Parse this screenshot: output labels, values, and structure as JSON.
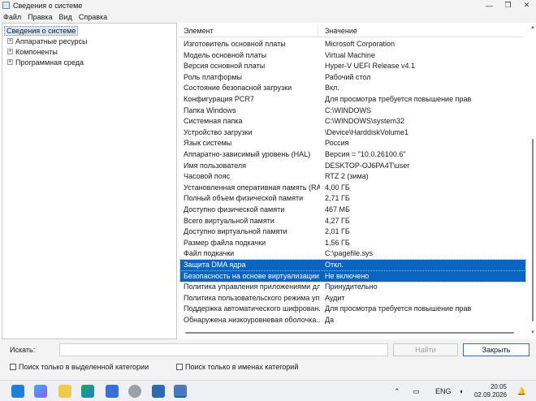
{
  "window": {
    "title": "Сведения о системе",
    "controls": {
      "minimize": "—",
      "maximize": "❐",
      "close": "✕"
    }
  },
  "menu": [
    "Файл",
    "Правка",
    "Вид",
    "Справка"
  ],
  "tree": {
    "root": "Сведения о системе",
    "children": [
      {
        "expander": "+",
        "label": "Аппаратные ресурсы"
      },
      {
        "expander": "+",
        "label": "Компоненты"
      },
      {
        "expander": "+",
        "label": "Программная среда"
      }
    ]
  },
  "list": {
    "columns": {
      "element": "Элемент",
      "value": "Значение"
    },
    "rows": [
      {
        "key": "Изготовитель основной платы",
        "value": "Microsoft Corporation"
      },
      {
        "key": "Модель основной платы",
        "value": "Virtual Machine"
      },
      {
        "key": "Версия основной платы",
        "value": "Hyper-V UEFI Release v4.1"
      },
      {
        "key": "Роль платформы",
        "value": "Рабочий стол"
      },
      {
        "key": "Состояние безопасной загрузки",
        "value": "Вкл."
      },
      {
        "key": "Конфигурация PCR7",
        "value": "Для просмотра требуется повышение прав"
      },
      {
        "key": "Папка Windows",
        "value": "C:\\WINDOWS"
      },
      {
        "key": "Системная папка",
        "value": "C:\\WINDOWS\\system32"
      },
      {
        "key": "Устройство загрузки",
        "value": "\\Device\\HarddiskVolume1"
      },
      {
        "key": "Язык системы",
        "value": "Россия"
      },
      {
        "key": "Аппаратно-зависимый уровень (HAL)",
        "value": "Версия = \"10.0.26100.6\""
      },
      {
        "key": "Имя пользователя",
        "value": "DESKTOP-OJ6PA4T\\user"
      },
      {
        "key": "Часовой пояс",
        "value": "RTZ 2 (зима)"
      },
      {
        "key": "Установленная оперативная память (RAM)",
        "value": "4,00 ГБ"
      },
      {
        "key": "Полный объем физической памяти",
        "value": "2,71 ГБ"
      },
      {
        "key": "Доступно физической памяти",
        "value": "467 МБ"
      },
      {
        "key": "Всего виртуальной памяти",
        "value": "4,27 ГБ"
      },
      {
        "key": "Доступно виртуальной памяти",
        "value": "2,01 ГБ"
      },
      {
        "key": "Размер файла подкачки",
        "value": "1,56 ГБ"
      },
      {
        "key": "Файл подкачки",
        "value": "C:\\pagefile.sys"
      },
      {
        "key": "Защита DMA ядра",
        "value": "Откл.",
        "selected": true
      },
      {
        "key": "Безопасность на основе виртуализации",
        "value": "Не включено",
        "selected": true
      },
      {
        "key": "Политика управления приложениями для ...",
        "value": "Принудительно"
      },
      {
        "key": "Политика пользовательского режима упр...",
        "value": "Аудит"
      },
      {
        "key": "Поддержка автоматического шифрован...",
        "value": "Для просмотра требуется повышение прав"
      },
      {
        "key": "Обнаружена низкоуровневая оболочка....",
        "value": "Да"
      }
    ]
  },
  "search": {
    "label": "Искать:",
    "value": "",
    "find_button": "Найти",
    "close_button": "Закрыть",
    "option_selected_category": "Поиск только в выделенной категории",
    "option_category_names": "Поиск только в именах категорий"
  },
  "taskbar": {
    "lang": "ENG",
    "time": "20:05",
    "date": "02.09.2026",
    "accent": "#0a64c0"
  }
}
